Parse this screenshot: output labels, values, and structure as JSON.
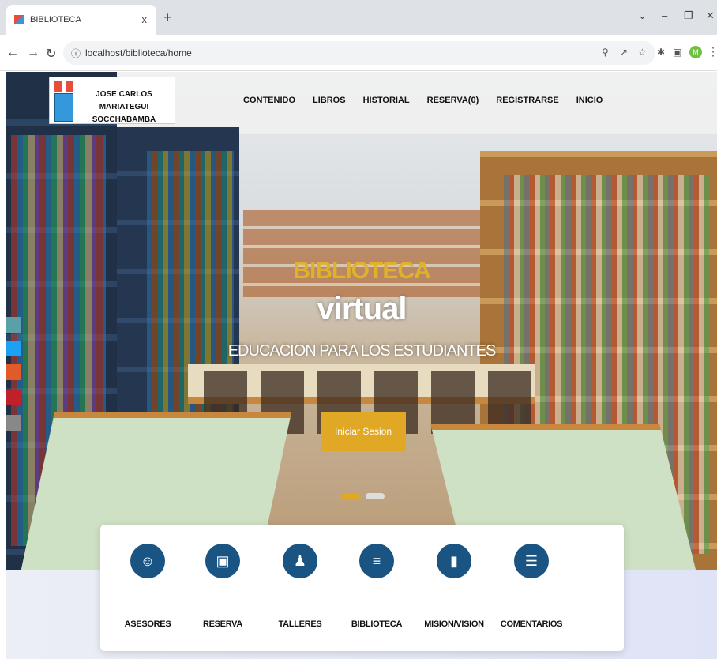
{
  "browser": {
    "tab_title": "BIBLIOTECA",
    "tab_close": "x",
    "new_tab": "+",
    "url": "localhost/biblioteca/home",
    "profile_initial": "M"
  },
  "nav": {
    "school_name_line1": "JOSE CARLOS MARIATEGUI",
    "school_name_line2": "SOCCHABAMBA",
    "menu": [
      "CONTENIDO",
      "LIBROS",
      "HISTORIAL",
      "RESERVA(0)",
      "REGISTRARSE",
      "INICIO"
    ]
  },
  "hero": {
    "title_line1": "BIBLIOTECA",
    "title_line2": "virtual",
    "subtitle": "EDUCACION PARA LOS ESTUDIANTES",
    "button_label": "Iniciar Sesion"
  },
  "features": [
    {
      "label": "ASESORES",
      "icon": "advisor-icon"
    },
    {
      "label": "RESERVA",
      "icon": "reserve-screen-icon"
    },
    {
      "label": "TALLERES",
      "icon": "graduate-icon"
    },
    {
      "label": "BIBLIOTECA",
      "icon": "books-stack-icon"
    },
    {
      "label": "MISION/VISION",
      "icon": "tablet-icon"
    },
    {
      "label": "COMENTARIOS",
      "icon": "comment-icon"
    }
  ],
  "colors": {
    "accent_gold": "#e0a824",
    "feature_blue": "#1a5483"
  }
}
